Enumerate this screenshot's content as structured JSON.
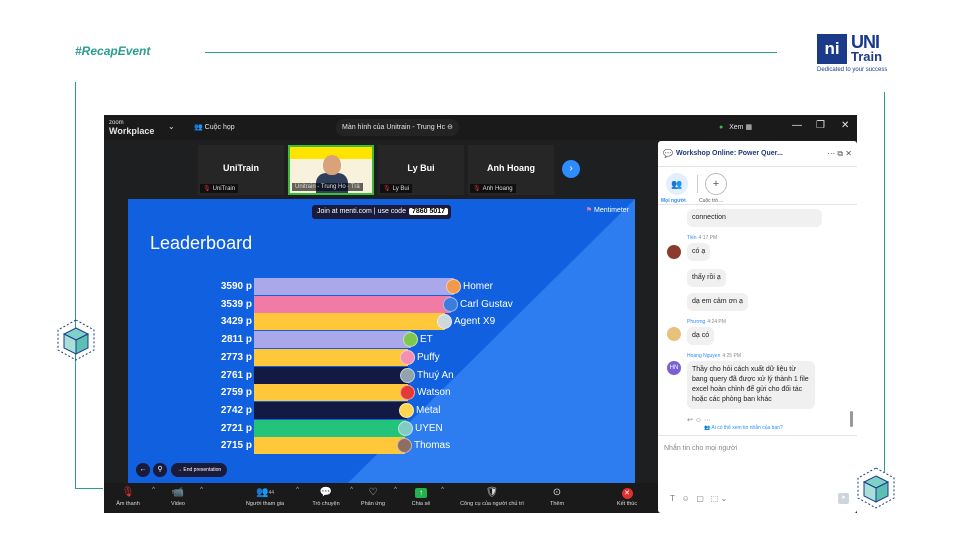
{
  "slide": {
    "hashtag": "#RecapEvent",
    "logo": {
      "box_text": "ni",
      "line1": "UNI",
      "line2": "Train",
      "tagline": "Dedicated to your success"
    }
  },
  "zoom": {
    "brand_top": "zoom",
    "brand_bottom": "Workplace",
    "meeting_label": "Cuộc họp",
    "share_tab": "Màn hình của Unitrain - Trung Hc",
    "view_label": "Xem",
    "tiles": [
      {
        "name": "UniTrain",
        "tag": "UniTrain",
        "video": false
      },
      {
        "name": "",
        "tag": "Unitrain - Trung Ho - Trả",
        "video": true
      },
      {
        "name": "Ly Bui",
        "tag": "Ly Bui",
        "video": false
      },
      {
        "name": "Anh Hoang",
        "tag": "Anh Hoang",
        "video": false
      }
    ],
    "toolbar": [
      {
        "label": "Âm thanh",
        "icon": "mic-muted-icon"
      },
      {
        "label": "Video",
        "icon": "video-off-icon"
      },
      {
        "label": "Người tham gia",
        "icon": "participants-icon",
        "count": "44"
      },
      {
        "label": "Trò chuyện",
        "icon": "chat-icon"
      },
      {
        "label": "Phản ứng",
        "icon": "reaction-icon"
      },
      {
        "label": "Chia sẻ",
        "icon": "share-icon"
      },
      {
        "label": "Công cụ của người chủ trì",
        "icon": "shield-icon"
      },
      {
        "label": "Thêm",
        "icon": "more-icon"
      },
      {
        "label": "Kết thúc",
        "icon": "end-icon"
      }
    ]
  },
  "menti": {
    "join_text": "Join at menti.com | use code",
    "code": "7860 5017",
    "brand": "Mentimeter",
    "title": "Leaderboard",
    "end_presentation": "End presentation",
    "colors": {
      "lavender": "#a9a8ea",
      "pink": "#f27ba6",
      "yellow": "#ffc83a",
      "navy": "#121a44",
      "green": "#22c47a",
      "bg": "#1060e0"
    }
  },
  "chart_data": {
    "type": "bar",
    "orientation": "horizontal",
    "title": "Leaderboard",
    "categories": [
      "Homer",
      "Carl Gustav",
      "Agent X9",
      "ET",
      "Puffy",
      "Thuý An",
      "Watson",
      "Metal",
      "UYEN",
      "Thomas"
    ],
    "values": [
      3590,
      3539,
      3429,
      2811,
      2773,
      2761,
      2759,
      2742,
      2721,
      2715
    ],
    "labels": [
      "3590 p",
      "3539 p",
      "3429 p",
      "2811 p",
      "2773 p",
      "2761 p",
      "2759 p",
      "2742 p",
      "2721 p",
      "2715 p"
    ],
    "bar_colors": [
      "#a9a8ea",
      "#f27ba6",
      "#ffc83a",
      "#a9a8ea",
      "#ffc83a",
      "#121a44",
      "#ffc83a",
      "#121a44",
      "#22c47a",
      "#ffc83a"
    ],
    "avatar_colors": [
      "#f2994a",
      "#3b7ddd",
      "#cfd8dc",
      "#7ec850",
      "#f48fb1",
      "#90a4ae",
      "#e53935",
      "#ffd54f",
      "#80cbc4",
      "#8d6e63"
    ]
  },
  "chat": {
    "title": "Workshop Online: Power Quer...",
    "tab_people": "Mọi người",
    "tab_chats": "Cuộc trò ...",
    "messages": [
      {
        "sender": "",
        "time": "",
        "text": "connection",
        "avatar": ""
      },
      {
        "sender": "Tiến",
        "time": "4:17 PM",
        "text": "có ạ",
        "avatar": ""
      },
      {
        "sender": "",
        "time": "",
        "text": "thấy rồi ạ",
        "avatar": ""
      },
      {
        "sender": "",
        "time": "",
        "text": "dạ em cảm ơn ạ",
        "avatar": ""
      },
      {
        "sender": "Phương",
        "time": "4:24 PM",
        "text": "dạ có",
        "avatar": ""
      },
      {
        "sender": "Hoang Nguyen",
        "time": "4:25 PM",
        "text": "Thầy cho hỏi cách xuất dữ liệu từ bang query đã được xử lý thành 1 file excel hoàn chỉnh để gửi cho đối tác hoặc các phòng ban khác",
        "avatar": "HN"
      }
    ],
    "seen_link": "Ai có thể xem tin nhắn của bạn?",
    "input_placeholder": "Nhắn tin cho mọi người"
  }
}
